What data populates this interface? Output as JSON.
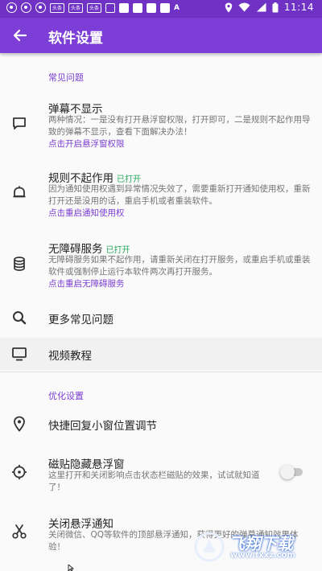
{
  "status_bar": {
    "badges": [
      "头条",
      "头条",
      "头条"
    ],
    "extra": "A",
    "time": "11:14"
  },
  "app_bar": {
    "title": "软件设置"
  },
  "sections": {
    "faq_header": "常见问题",
    "opt_header": "优化设置"
  },
  "items": {
    "danmu": {
      "title": "弹幕不显示",
      "desc": "两种情况：一是没有打开悬浮窗权限，打开即可，二是规则不起作用导致的弹幕不显示，查看下面解决办法！",
      "link": "点击开启悬浮窗权限",
      "icon": "message-icon"
    },
    "rules": {
      "title": "规则不起作用",
      "tag": "已打开",
      "desc": "因为通知使用权遇到异常情况失效了，需要重新打开通知使用权，重新打开还是没用的话，重启手机或者重装软件。",
      "link": "点击重启通知使用权",
      "icon": "bell-icon"
    },
    "accessibility": {
      "title": "无障碍服务",
      "tag": "已打开",
      "desc": "无障碍服务如果不起作用，请重新关闭在打开服务，或重启手机或重装软件或强制停止运行本软件两次再打开服务。",
      "link": "点击重启无障碍服务",
      "icon": "database-icon"
    },
    "more_faq": {
      "title": "更多常见问题",
      "icon": "search-icon"
    },
    "video": {
      "title": "视频教程",
      "icon": "monitor-icon"
    },
    "quick_reply": {
      "title": "快捷回复小窗位置调节",
      "icon": "location-pin-icon"
    },
    "tile_hide": {
      "title": "磁贴隐藏悬浮窗",
      "desc": "这里打开和关闭影响点击状态栏磁贴的效果，试试就知道了！",
      "toggle_on": false,
      "icon": "crosshair-icon"
    },
    "close_float": {
      "title": "关闭悬浮通知",
      "desc": "关闭微信、QQ等软件的顶部悬浮通知，获得更好的弹幕通知效果体验！",
      "icon": "scissors-icon"
    }
  },
  "watermark": {
    "title": "飞翔下载",
    "url": "www.fxxz.com"
  },
  "colors": {
    "primary": "#7c3ed6",
    "primary_dark": "#6f32c4",
    "accent_text": "#7b3ed2",
    "on_green": "#24a85a"
  }
}
